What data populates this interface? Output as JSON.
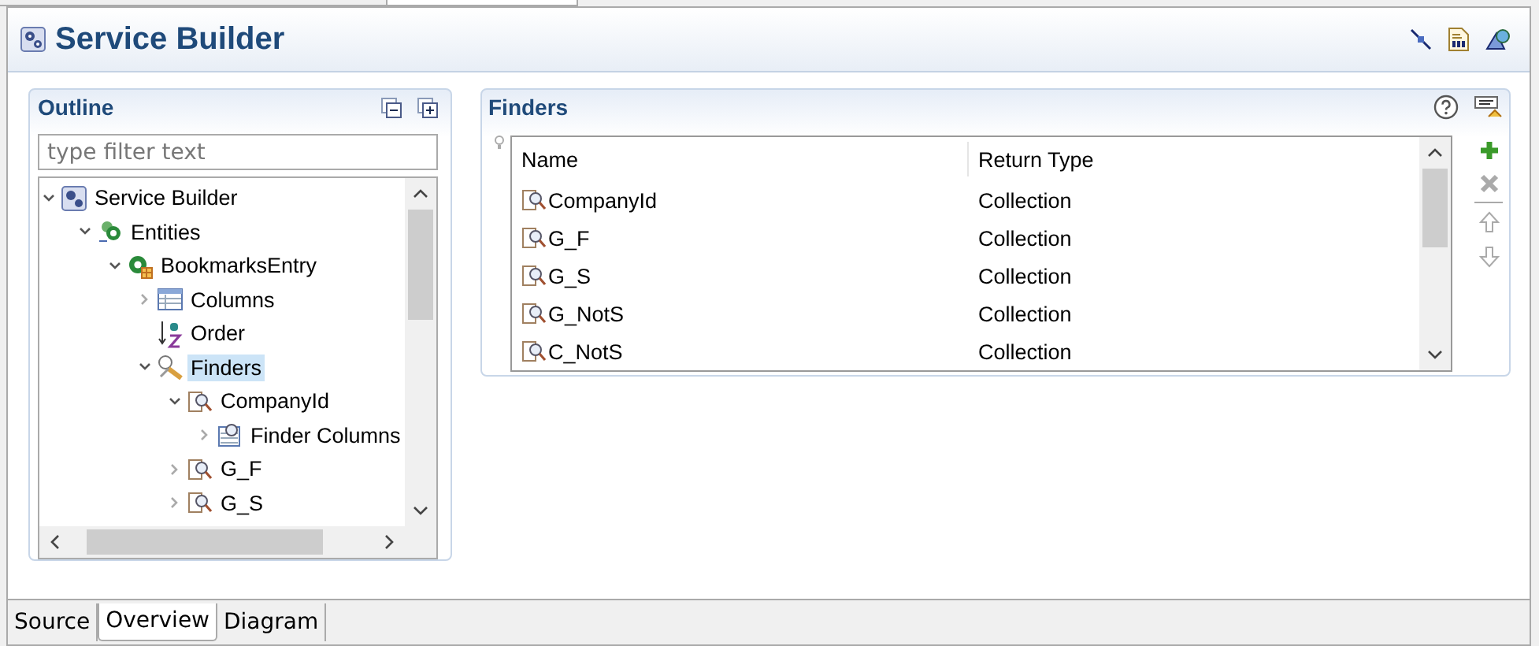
{
  "editor": {
    "title": "Service Builder"
  },
  "outline": {
    "title": "Outline",
    "filter": {
      "placeholder": "type filter text"
    },
    "tree": [
      {
        "label": "Service Builder",
        "kind": "builder",
        "has_children": true,
        "expanded": true,
        "selected": false,
        "children": [
          {
            "label": "Entities",
            "kind": "entities",
            "has_children": true,
            "expanded": true,
            "selected": false,
            "children": [
              {
                "label": "BookmarksEntry",
                "kind": "entity",
                "has_children": true,
                "expanded": true,
                "selected": false,
                "children": [
                  {
                    "label": "Columns",
                    "kind": "columns",
                    "has_children": true,
                    "expanded": false,
                    "selected": false
                  },
                  {
                    "label": "Order",
                    "kind": "order",
                    "selected": false
                  },
                  {
                    "label": "Finders",
                    "kind": "finders",
                    "has_children": true,
                    "expanded": true,
                    "selected": true,
                    "children": [
                      {
                        "label": "CompanyId",
                        "kind": "finder",
                        "has_children": true,
                        "expanded": true,
                        "selected": false,
                        "children": [
                          {
                            "label": "Finder Columns",
                            "kind": "finder-columns",
                            "has_children": true,
                            "expanded": false,
                            "selected": false
                          }
                        ]
                      },
                      {
                        "label": "G_F",
                        "kind": "finder",
                        "has_children": true,
                        "expanded": false,
                        "selected": false
                      },
                      {
                        "label": "G_S",
                        "kind": "finder",
                        "has_children": true,
                        "expanded": false,
                        "selected": false
                      }
                    ]
                  }
                ]
              }
            ]
          }
        ]
      }
    ]
  },
  "finders": {
    "title": "Finders",
    "columns": [
      "Name",
      "Return Type"
    ],
    "rows": [
      {
        "name": "CompanyId",
        "return_type": "Collection"
      },
      {
        "name": "G_F",
        "return_type": "Collection"
      },
      {
        "name": "G_S",
        "return_type": "Collection"
      },
      {
        "name": "G_NotS",
        "return_type": "Collection"
      },
      {
        "name": "C_NotS",
        "return_type": "Collection"
      }
    ]
  },
  "bottom_tabs": [
    {
      "label": "Source",
      "selected": false
    },
    {
      "label": "Overview",
      "selected": true
    },
    {
      "label": "Diagram",
      "selected": false
    }
  ]
}
